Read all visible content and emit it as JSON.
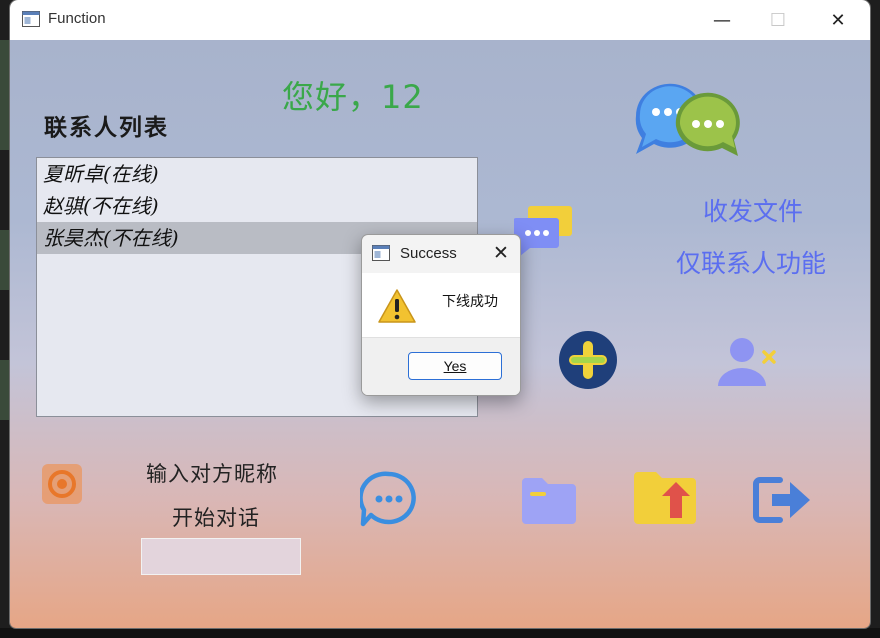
{
  "window": {
    "title": "Function",
    "minimize_glyph": "—",
    "maximize_glyph": "☐",
    "close_glyph": "✕"
  },
  "greeting": "您好，12",
  "contacts": {
    "title": "联系人列表",
    "items": [
      {
        "label": "夏昕卓(在线)",
        "selected": false
      },
      {
        "label": "赵骐(不在线)",
        "selected": false
      },
      {
        "label": "张昊杰(不在线)",
        "selected": true
      }
    ]
  },
  "labels": {
    "send_file": "收发文件",
    "contact_only": "仅联系人功能"
  },
  "chat_start": {
    "hint_line1": "输入对方昵称",
    "hint_line2": "开始对话",
    "nickname_value": "",
    "nickname_placeholder": ""
  },
  "dialog": {
    "title": "Success",
    "message": "下线成功",
    "yes_label": "Yes",
    "close_glyph": "✕"
  },
  "colors": {
    "greeting": "#3aa84a",
    "blue_label": "#5b6ef0",
    "accent_button": "#2c6fd6"
  },
  "icons": [
    "chat-bubbles-icon",
    "message-icon",
    "add-icon",
    "add-user-icon",
    "settings-icon",
    "chat-icon",
    "folder-icon",
    "upload-icon",
    "logout-icon",
    "warning-icon"
  ]
}
